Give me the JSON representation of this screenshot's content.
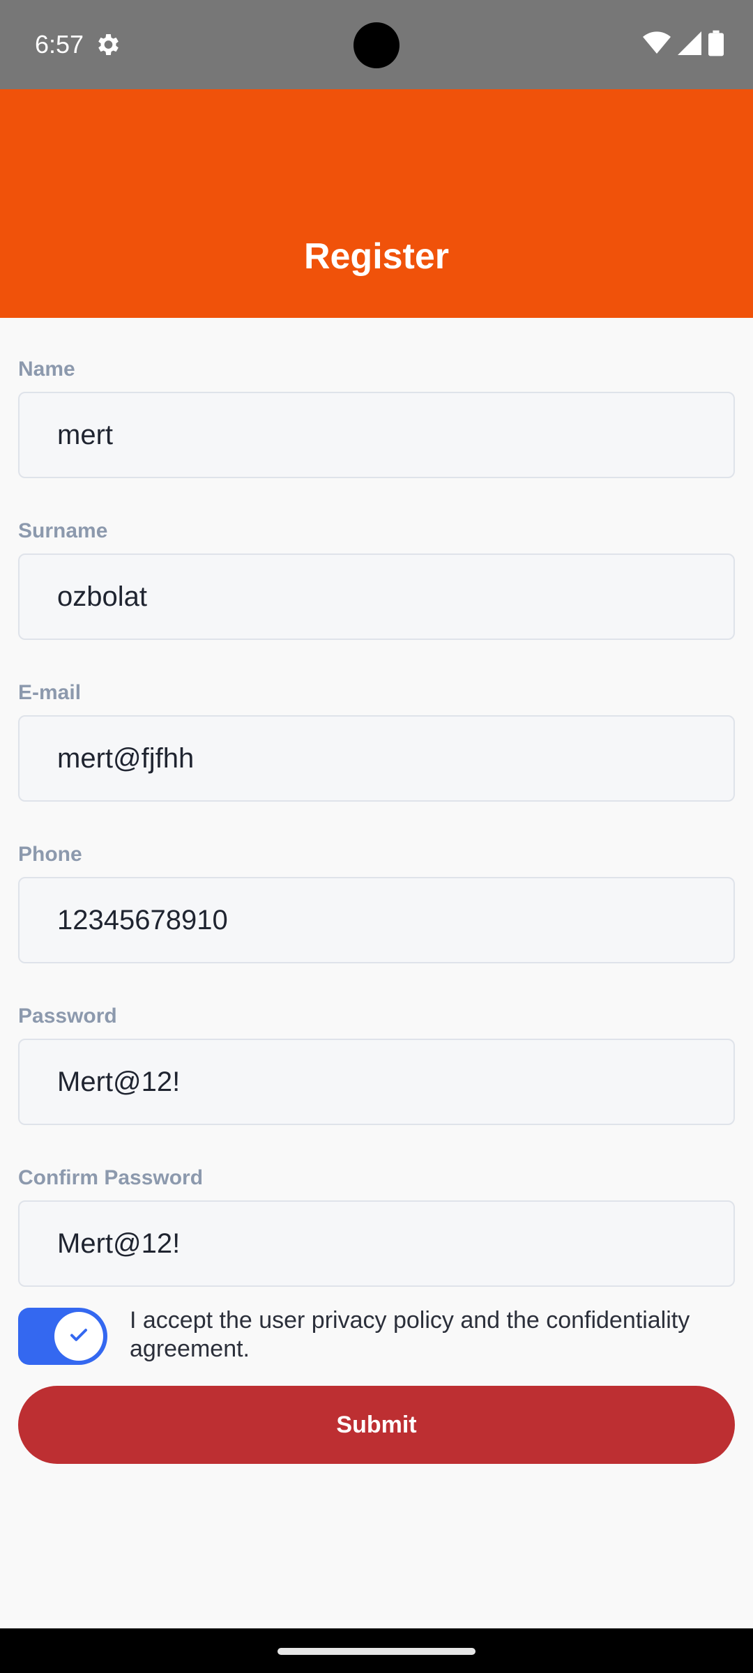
{
  "status_bar": {
    "time": "6:57",
    "icons": [
      "settings-gear-icon",
      "wifi-icon",
      "cellular-signal-icon",
      "battery-icon"
    ]
  },
  "header": {
    "title": "Register",
    "background_color": "#f0520a"
  },
  "form": {
    "fields": [
      {
        "label": "Name",
        "value": "mert"
      },
      {
        "label": "Surname",
        "value": "ozbolat"
      },
      {
        "label": "E-mail",
        "value": "mert@fjfhh"
      },
      {
        "label": "Phone",
        "value": "12345678910"
      },
      {
        "label": "Password",
        "value": "Mert@12!"
      },
      {
        "label": "Confirm Password",
        "value": "Mert@12!"
      }
    ]
  },
  "consent": {
    "checked": true,
    "text": "I accept the user privacy policy and the confidentiality agreement.",
    "toggle_color": "#3468f0"
  },
  "submit": {
    "label": "Submit",
    "color": "#bd2f32"
  }
}
